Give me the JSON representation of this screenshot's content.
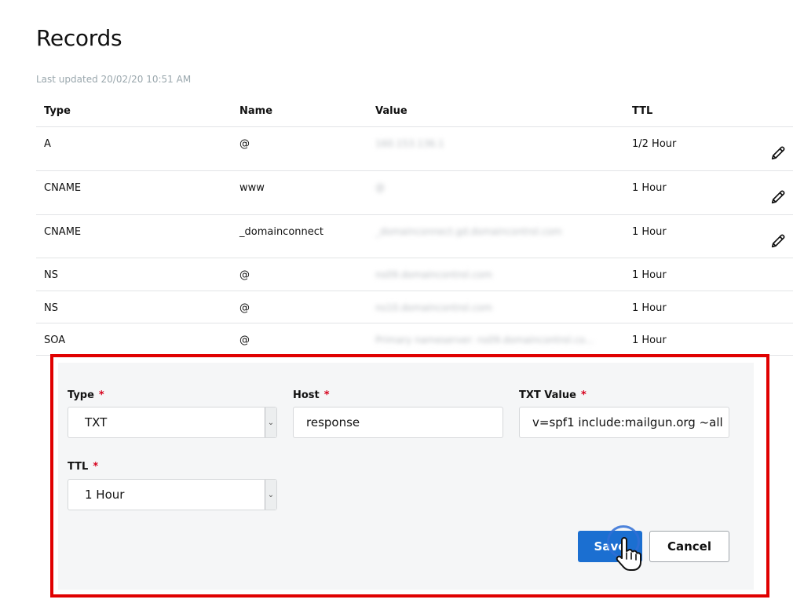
{
  "page": {
    "title": "Records",
    "last_updated": "Last updated 20/02/20 10:51 AM"
  },
  "table": {
    "headers": {
      "type": "Type",
      "name": "Name",
      "value": "Value",
      "ttl": "TTL"
    },
    "rows": [
      {
        "type": "A",
        "name": "@",
        "value": "160.153.136.1",
        "ttl": "1/2 Hour",
        "editable": true
      },
      {
        "type": "CNAME",
        "name": "www",
        "value": "@",
        "ttl": "1 Hour",
        "editable": true
      },
      {
        "type": "CNAME",
        "name": "_domainconnect",
        "value": "_domainconnect.gd.domaincontrol.com",
        "ttl": "1 Hour",
        "editable": true
      },
      {
        "type": "NS",
        "name": "@",
        "value": "ns09.domaincontrol.com",
        "ttl": "1 Hour",
        "editable": false
      },
      {
        "type": "NS",
        "name": "@",
        "value": "ns10.domaincontrol.com",
        "ttl": "1 Hour",
        "editable": false
      },
      {
        "type": "SOA",
        "name": "@",
        "value": "Primary nameserver: ns09.domaincontrol.co...",
        "ttl": "1 Hour",
        "editable": false
      }
    ]
  },
  "form": {
    "type_label": "Type",
    "type_value": "TXT",
    "host_label": "Host",
    "host_value": "response",
    "txt_label": "TXT Value",
    "txt_value": "v=spf1 include:mailgun.org ~all",
    "ttl_label": "TTL",
    "ttl_value": "1 Hour",
    "required_mark": "*",
    "save_label": "Save",
    "cancel_label": "Cancel"
  },
  "icons": {
    "edit": "pencil-icon",
    "dropdown": "chevron-down-icon",
    "cursor": "hand-pointer-icon"
  },
  "colors": {
    "accent": "#1b6fd1",
    "required": "#d6001c",
    "highlight_border": "#e00000"
  }
}
